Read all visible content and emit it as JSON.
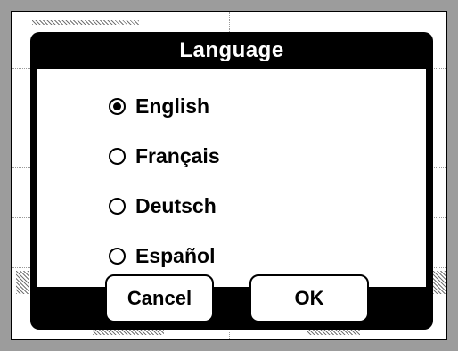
{
  "dialog": {
    "title": "Language",
    "options": [
      {
        "label": "English",
        "selected": true
      },
      {
        "label": "Français",
        "selected": false
      },
      {
        "label": "Deutsch",
        "selected": false
      },
      {
        "label": "Español",
        "selected": false
      }
    ],
    "cancel_label": "Cancel",
    "ok_label": "OK"
  },
  "colors": {
    "backdrop": "#9c9c9c",
    "dialog_frame": "#000000",
    "dialog_body": "#ffffff"
  },
  "icons": {
    "radio_selected": "radio-selected-icon",
    "radio_unselected": "radio-unselected-icon"
  }
}
